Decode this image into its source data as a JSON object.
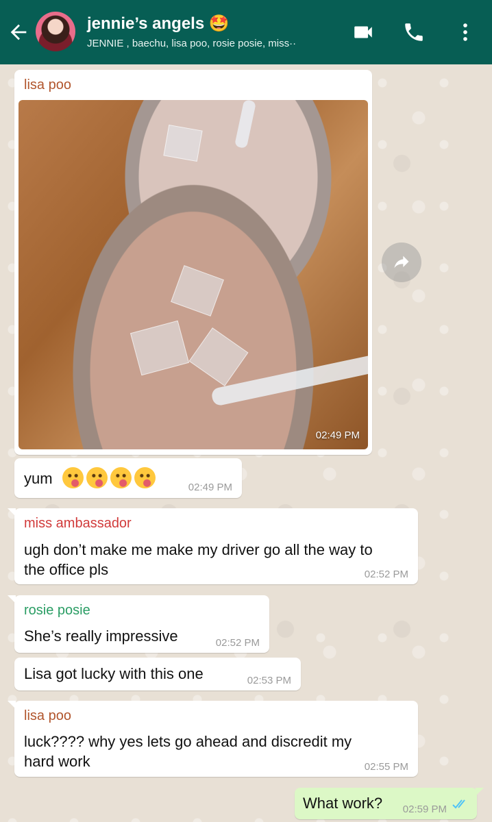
{
  "header": {
    "title": "jennie’s angels 🤩",
    "members": "JENNIE , baechu, lisa poo, rosie posie, miss",
    "more": "··"
  },
  "colors": {
    "header_bg": "#075e54",
    "sender_lisa": "#b1552c",
    "sender_miss": "#d13a3a",
    "sender_rosie": "#2a9d64",
    "outgoing_bubble": "#dcf8c6",
    "read_ticks": "#4fc3f7"
  },
  "messages": [
    {
      "sender": "lisa poo",
      "type": "image",
      "time": "02:49 PM"
    },
    {
      "text": "yum",
      "emoji_count": 4,
      "emoji": "face-savoring-food-emoji",
      "time": "02:49 PM"
    },
    {
      "sender": "miss ambassador",
      "text_line1": "ugh don’t make me make my driver go all the way to",
      "text_line2": "the office pls",
      "time": "02:52 PM"
    },
    {
      "sender": "rosie posie",
      "text": "She’s really impressive",
      "time": "02:52 PM"
    },
    {
      "text": "Lisa got lucky with this one",
      "time": "02:53 PM"
    },
    {
      "sender": "lisa poo",
      "text_line1": "luck???? why yes lets go ahead and discredit my",
      "text_line2": "hard work",
      "time": "02:55 PM"
    },
    {
      "text": "What work?",
      "time": "02:59 PM",
      "status": "read"
    }
  ]
}
